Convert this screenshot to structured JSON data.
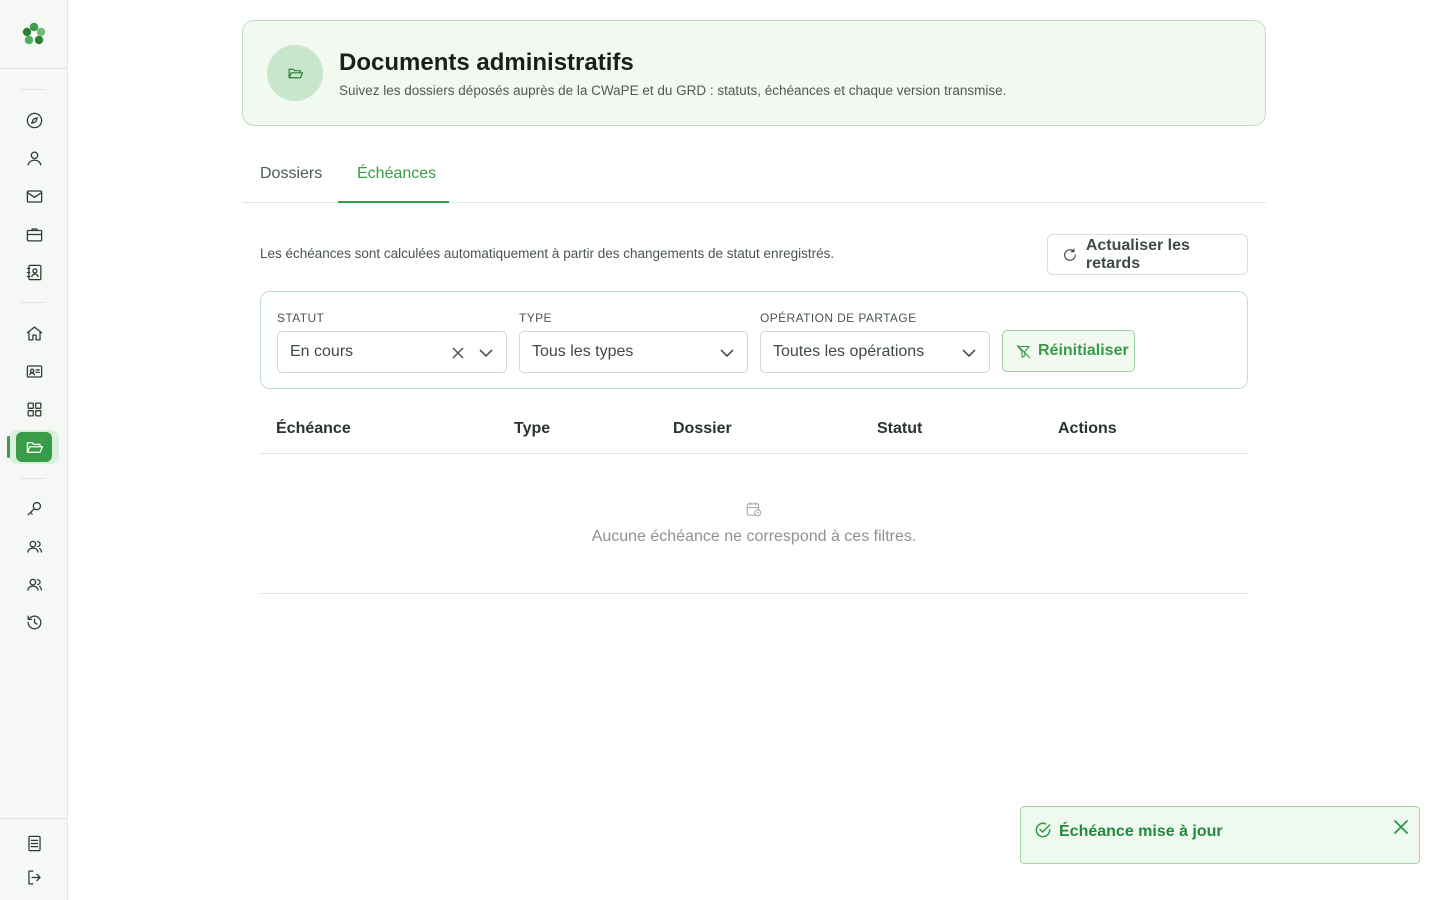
{
  "sidebar": {
    "logo": "clover-logo",
    "items_top": [
      {
        "icon": "compass-icon"
      },
      {
        "icon": "user-icon"
      },
      {
        "icon": "mail-icon"
      },
      {
        "icon": "briefcase-icon"
      },
      {
        "icon": "contact-book-icon"
      }
    ],
    "items_mid": [
      {
        "icon": "home-icon"
      },
      {
        "icon": "id-card-icon"
      },
      {
        "icon": "grid-icon"
      },
      {
        "icon": "folder-open-icon",
        "active": true
      }
    ],
    "items_low": [
      {
        "icon": "key-icon"
      },
      {
        "icon": "users-icon"
      },
      {
        "icon": "team-icon"
      },
      {
        "icon": "history-icon"
      }
    ],
    "items_bottom": [
      {
        "icon": "document-list-icon"
      },
      {
        "icon": "logout-icon"
      }
    ]
  },
  "header": {
    "title": "Documents administratifs",
    "subtitle": "Suivez les dossiers déposés auprès de la CWaPE et du GRD : statuts, échéances et chaque version transmise."
  },
  "tabs": [
    {
      "label": "Dossiers",
      "active": false
    },
    {
      "label": "Échéances",
      "active": true
    }
  ],
  "info": "Les échéances sont calculées automatiquement à partir des changements de statut enregistrés.",
  "refresh_button": "Actualiser les retards",
  "filters": {
    "status": {
      "label": "Statut",
      "value": "En cours"
    },
    "type": {
      "label": "Type",
      "value": "Tous les types"
    },
    "operation": {
      "label": "Opération de partage",
      "value": "Toutes les opérations"
    },
    "reset_button": "Réinitialiser"
  },
  "table": {
    "columns": [
      "Échéance",
      "Type",
      "Dossier",
      "Statut",
      "Actions"
    ],
    "rows": [],
    "empty_message": "Aucune échéance ne correspond à ces filtres."
  },
  "toast": {
    "message": "Échéance mise à jour",
    "type": "success"
  },
  "colors": {
    "accent": "#3a9b48",
    "accent_light": "#f1f9f1",
    "border_green": "#bfe0c3"
  }
}
